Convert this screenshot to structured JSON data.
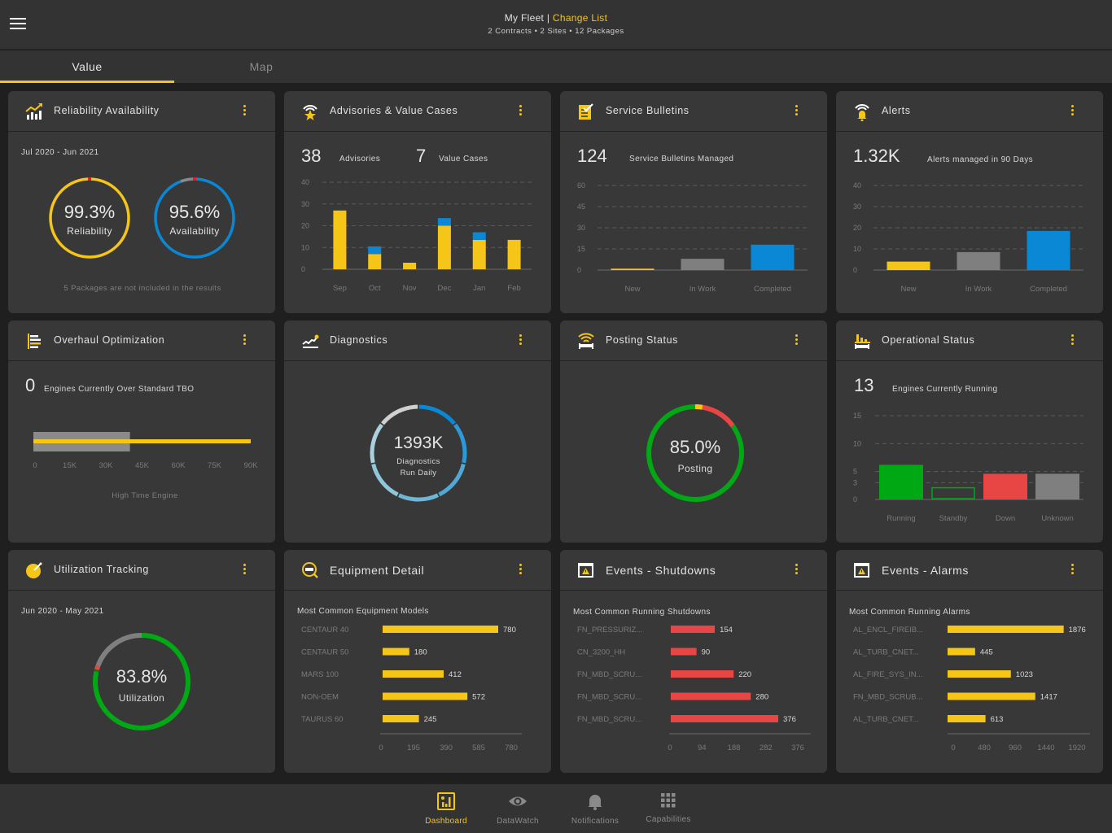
{
  "header": {
    "fleet_label": "My Fleet",
    "separator": " | ",
    "change_list_label": "Change List",
    "subtitle": "2 Contracts • 2 Sites • 12 Packages"
  },
  "tabs": [
    {
      "label": "Value",
      "active": true
    },
    {
      "label": "Map",
      "active": false
    }
  ],
  "colors": {
    "accent": "#f5c518",
    "blue": "#0a88d6",
    "gray": "#7f7f7f",
    "green": "#00a814",
    "red": "#e84545"
  },
  "cards": {
    "reliability": {
      "title": "Reliability Availability",
      "icon": "trending-chart-icon",
      "period": "Jul 2020 - Jun 2021",
      "reliability_value": "99.3%",
      "reliability_label": "Reliability",
      "reliability_pct": 99.3,
      "availability_value": "95.6%",
      "availability_label": "Availability",
      "availability_pct": 95.6,
      "footnote": "5 Packages are not included in the results"
    },
    "advisories": {
      "title": "Advisories & Value Cases",
      "icon": "star-broadcast-icon",
      "advisories_count": "38",
      "advisories_label": "Advisories",
      "value_cases_count": "7",
      "value_cases_label": "Value Cases"
    },
    "service_bulletins": {
      "title": "Service Bulletins",
      "icon": "checklist-icon",
      "count": "124",
      "label": "Service Bulletins Managed"
    },
    "alerts": {
      "title": "Alerts",
      "icon": "bell-broadcast-icon",
      "count": "1.32K",
      "label": "Alerts managed in 90 Days"
    },
    "overhaul": {
      "title": "Overhaul Optimization",
      "icon": "bars-list-icon",
      "count": "0",
      "label": "Engines Currently Over Standard TBO",
      "axis_label": "High Time Engine"
    },
    "diagnostics": {
      "title": "Diagnostics",
      "icon": "line-chart-icon",
      "value": "1393K",
      "label_line1": "Diagnostics",
      "label_line2": "Run Daily"
    },
    "posting": {
      "title": "Posting Status",
      "icon": "wifi-engine-icon",
      "value": "85.0%",
      "label": "Posting"
    },
    "operational": {
      "title": "Operational Status",
      "icon": "factory-engine-icon",
      "count": "13",
      "label": "Engines Currently Running"
    },
    "utilization": {
      "title": "Utilization Tracking",
      "icon": "pie-gauge-icon",
      "period": "Jun 2020 - May 2021",
      "value": "83.8%",
      "label": "Utilization"
    },
    "equipment": {
      "title": "Equipment Detail",
      "icon": "engine-search-icon",
      "subtitle": "Most Common Equipment Models"
    },
    "shutdowns": {
      "title": "Events - Shutdowns",
      "icon": "calendar-warning-icon",
      "subtitle": "Most Common Running  Shutdowns"
    },
    "alarms": {
      "title": "Events - Alarms",
      "icon": "calendar-warning-icon",
      "subtitle": "Most Common Running Alarms"
    }
  },
  "bottom_nav": [
    {
      "label": "Dashboard",
      "icon": "dashboard-icon",
      "active": true
    },
    {
      "label": "DataWatch",
      "icon": "eye-icon",
      "active": false
    },
    {
      "label": "Notifications",
      "icon": "bell-icon",
      "active": false
    },
    {
      "label": "Capabilities",
      "icon": "grid-icon",
      "active": false
    }
  ],
  "chart_data": [
    {
      "id": "advisories",
      "type": "bar",
      "stacked": true,
      "title": "Advisories & Value Cases",
      "categories": [
        "Sep",
        "Oct",
        "Nov",
        "Dec",
        "Jan",
        "Feb"
      ],
      "series": [
        {
          "name": "Advisories",
          "color": "#f5c518",
          "values": [
            27,
            7,
            3,
            20,
            13.5,
            13.5
          ]
        },
        {
          "name": "Value Cases",
          "color": "#0a88d6",
          "values": [
            0,
            3.5,
            0,
            3.5,
            3.5,
            0
          ]
        }
      ],
      "yticks": [
        0,
        10,
        20,
        30,
        40
      ],
      "ylim": [
        0,
        40
      ],
      "grid": true
    },
    {
      "id": "service_bulletins",
      "type": "bar",
      "title": "Service Bulletins",
      "categories": [
        "New",
        "In Work",
        "Completed"
      ],
      "values": [
        1,
        8,
        18
      ],
      "colors": [
        "#f5c518",
        "#7f7f7f",
        "#0a88d6"
      ],
      "yticks": [
        0,
        15,
        30,
        45,
        60
      ],
      "ylim": [
        0,
        60
      ],
      "grid": true
    },
    {
      "id": "alerts",
      "type": "bar",
      "title": "Alerts",
      "categories": [
        "New",
        "In Work",
        "Completed"
      ],
      "values": [
        4,
        8.5,
        18.5
      ],
      "colors": [
        "#f5c518",
        "#7f7f7f",
        "#0a88d6"
      ],
      "yticks": [
        0,
        10,
        20,
        30,
        40
      ],
      "ylim": [
        0,
        40
      ],
      "grid": true
    },
    {
      "id": "overhaul",
      "type": "bar",
      "orientation": "horizontal",
      "title": "High Time Engine",
      "range_band": [
        0,
        40000
      ],
      "line_value": 90000,
      "xticks": [
        "0",
        "15K",
        "30K",
        "45K",
        "60K",
        "75K",
        "90K"
      ],
      "xlim": [
        0,
        90000
      ]
    },
    {
      "id": "diagnostics",
      "type": "pie",
      "title": "Diagnostics Run Daily",
      "total_label": "1393K",
      "segments": [
        {
          "color": "#0a88d6",
          "value": 1
        },
        {
          "color": "#2b9ad8",
          "value": 1
        },
        {
          "color": "#4ea9d6",
          "value": 1
        },
        {
          "color": "#6db6d6",
          "value": 1
        },
        {
          "color": "#8fc7da",
          "value": 1
        },
        {
          "color": "#a9d2de",
          "value": 1
        },
        {
          "color": "#d0d0d0",
          "value": 1
        }
      ]
    },
    {
      "id": "posting",
      "type": "pie",
      "title": "Posting",
      "segments": [
        {
          "name": "Posting",
          "color": "#00a814",
          "value": 85.0
        },
        {
          "name": "Warning",
          "color": "#f5c518",
          "value": 2.5
        },
        {
          "name": "Not Posting",
          "color": "#e84545",
          "value": 12.5
        }
      ]
    },
    {
      "id": "operational",
      "type": "bar",
      "title": "Operational Status",
      "categories": [
        "Running",
        "Standby",
        "Down",
        "Unknown"
      ],
      "values": [
        6.2,
        2.1,
        4.6,
        4.6
      ],
      "colors": [
        "#00a814",
        "outline-green",
        "#e84545",
        "#7f7f7f"
      ],
      "yticks": [
        0,
        3,
        5,
        10,
        15
      ],
      "ylim": [
        0,
        15
      ],
      "grid": true
    },
    {
      "id": "utilization",
      "type": "pie",
      "title": "Utilization",
      "segments": [
        {
          "name": "Utilized",
          "color": "#00a814",
          "value": 78.5
        },
        {
          "name": "Other",
          "color": "#1d6b1d",
          "value": 0.7
        },
        {
          "name": "Down",
          "color": "#e84545",
          "value": 1.3
        },
        {
          "name": "Idle",
          "color": "#7f7f7f",
          "value": 19.5
        }
      ]
    },
    {
      "id": "equipment",
      "type": "bar",
      "orientation": "horizontal",
      "title": "Most Common Equipment Models",
      "categories": [
        "CENTAUR 40",
        "CENTAUR 50",
        "MARS 100",
        "NON-OEM",
        "TAURUS 60"
      ],
      "values": [
        780,
        180,
        412,
        572,
        245
      ],
      "color": "#f5c518",
      "xticks": [
        0,
        195,
        390,
        585,
        780
      ],
      "xlim": [
        0,
        780
      ]
    },
    {
      "id": "shutdowns",
      "type": "bar",
      "orientation": "horizontal",
      "title": "Most Common Running  Shutdowns",
      "categories": [
        "FN_PRESSURIZ...",
        "CN_3200_HH",
        "FN_MBD_SCRU...",
        "FN_MBD_SCRU...",
        "FN_MBD_SCRU..."
      ],
      "values": [
        154,
        90,
        220,
        280,
        376
      ],
      "color": "#e84545",
      "xticks": [
        0,
        94,
        188,
        282,
        376
      ],
      "xlim": [
        0,
        376
      ]
    },
    {
      "id": "alarms",
      "type": "bar",
      "orientation": "horizontal",
      "title": "Most Common Running Alarms",
      "categories": [
        "AL_ENCL_FIREIB...",
        "AL_TURB_CNET...",
        "AL_FIRE_SYS_IN...",
        "FN_MBD_SCRUB...",
        "AL_TURB_CNET..."
      ],
      "values": [
        1876,
        445,
        1023,
        1417,
        613
      ],
      "color": "#f5c518",
      "xticks": [
        0,
        480,
        960,
        1440,
        1920
      ],
      "xlim": [
        0,
        1920
      ]
    }
  ]
}
